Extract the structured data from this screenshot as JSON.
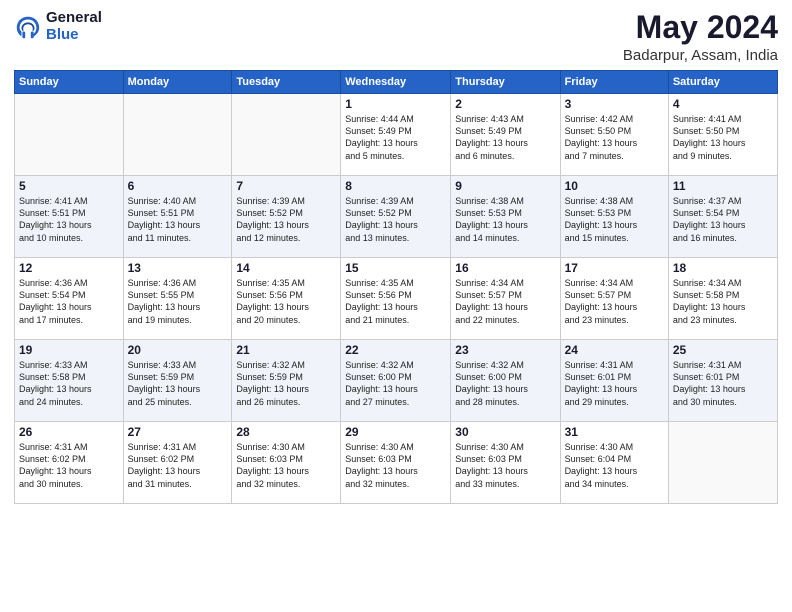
{
  "logo": {
    "general": "General",
    "blue": "Blue"
  },
  "title": "May 2024",
  "subtitle": "Badarpur, Assam, India",
  "headers": [
    "Sunday",
    "Monday",
    "Tuesday",
    "Wednesday",
    "Thursday",
    "Friday",
    "Saturday"
  ],
  "weeks": [
    [
      {
        "num": "",
        "info": ""
      },
      {
        "num": "",
        "info": ""
      },
      {
        "num": "",
        "info": ""
      },
      {
        "num": "1",
        "info": "Sunrise: 4:44 AM\nSunset: 5:49 PM\nDaylight: 13 hours\nand 5 minutes."
      },
      {
        "num": "2",
        "info": "Sunrise: 4:43 AM\nSunset: 5:49 PM\nDaylight: 13 hours\nand 6 minutes."
      },
      {
        "num": "3",
        "info": "Sunrise: 4:42 AM\nSunset: 5:50 PM\nDaylight: 13 hours\nand 7 minutes."
      },
      {
        "num": "4",
        "info": "Sunrise: 4:41 AM\nSunset: 5:50 PM\nDaylight: 13 hours\nand 9 minutes."
      }
    ],
    [
      {
        "num": "5",
        "info": "Sunrise: 4:41 AM\nSunset: 5:51 PM\nDaylight: 13 hours\nand 10 minutes."
      },
      {
        "num": "6",
        "info": "Sunrise: 4:40 AM\nSunset: 5:51 PM\nDaylight: 13 hours\nand 11 minutes."
      },
      {
        "num": "7",
        "info": "Sunrise: 4:39 AM\nSunset: 5:52 PM\nDaylight: 13 hours\nand 12 minutes."
      },
      {
        "num": "8",
        "info": "Sunrise: 4:39 AM\nSunset: 5:52 PM\nDaylight: 13 hours\nand 13 minutes."
      },
      {
        "num": "9",
        "info": "Sunrise: 4:38 AM\nSunset: 5:53 PM\nDaylight: 13 hours\nand 14 minutes."
      },
      {
        "num": "10",
        "info": "Sunrise: 4:38 AM\nSunset: 5:53 PM\nDaylight: 13 hours\nand 15 minutes."
      },
      {
        "num": "11",
        "info": "Sunrise: 4:37 AM\nSunset: 5:54 PM\nDaylight: 13 hours\nand 16 minutes."
      }
    ],
    [
      {
        "num": "12",
        "info": "Sunrise: 4:36 AM\nSunset: 5:54 PM\nDaylight: 13 hours\nand 17 minutes."
      },
      {
        "num": "13",
        "info": "Sunrise: 4:36 AM\nSunset: 5:55 PM\nDaylight: 13 hours\nand 19 minutes."
      },
      {
        "num": "14",
        "info": "Sunrise: 4:35 AM\nSunset: 5:56 PM\nDaylight: 13 hours\nand 20 minutes."
      },
      {
        "num": "15",
        "info": "Sunrise: 4:35 AM\nSunset: 5:56 PM\nDaylight: 13 hours\nand 21 minutes."
      },
      {
        "num": "16",
        "info": "Sunrise: 4:34 AM\nSunset: 5:57 PM\nDaylight: 13 hours\nand 22 minutes."
      },
      {
        "num": "17",
        "info": "Sunrise: 4:34 AM\nSunset: 5:57 PM\nDaylight: 13 hours\nand 23 minutes."
      },
      {
        "num": "18",
        "info": "Sunrise: 4:34 AM\nSunset: 5:58 PM\nDaylight: 13 hours\nand 23 minutes."
      }
    ],
    [
      {
        "num": "19",
        "info": "Sunrise: 4:33 AM\nSunset: 5:58 PM\nDaylight: 13 hours\nand 24 minutes."
      },
      {
        "num": "20",
        "info": "Sunrise: 4:33 AM\nSunset: 5:59 PM\nDaylight: 13 hours\nand 25 minutes."
      },
      {
        "num": "21",
        "info": "Sunrise: 4:32 AM\nSunset: 5:59 PM\nDaylight: 13 hours\nand 26 minutes."
      },
      {
        "num": "22",
        "info": "Sunrise: 4:32 AM\nSunset: 6:00 PM\nDaylight: 13 hours\nand 27 minutes."
      },
      {
        "num": "23",
        "info": "Sunrise: 4:32 AM\nSunset: 6:00 PM\nDaylight: 13 hours\nand 28 minutes."
      },
      {
        "num": "24",
        "info": "Sunrise: 4:31 AM\nSunset: 6:01 PM\nDaylight: 13 hours\nand 29 minutes."
      },
      {
        "num": "25",
        "info": "Sunrise: 4:31 AM\nSunset: 6:01 PM\nDaylight: 13 hours\nand 30 minutes."
      }
    ],
    [
      {
        "num": "26",
        "info": "Sunrise: 4:31 AM\nSunset: 6:02 PM\nDaylight: 13 hours\nand 30 minutes."
      },
      {
        "num": "27",
        "info": "Sunrise: 4:31 AM\nSunset: 6:02 PM\nDaylight: 13 hours\nand 31 minutes."
      },
      {
        "num": "28",
        "info": "Sunrise: 4:30 AM\nSunset: 6:03 PM\nDaylight: 13 hours\nand 32 minutes."
      },
      {
        "num": "29",
        "info": "Sunrise: 4:30 AM\nSunset: 6:03 PM\nDaylight: 13 hours\nand 32 minutes."
      },
      {
        "num": "30",
        "info": "Sunrise: 4:30 AM\nSunset: 6:03 PM\nDaylight: 13 hours\nand 33 minutes."
      },
      {
        "num": "31",
        "info": "Sunrise: 4:30 AM\nSunset: 6:04 PM\nDaylight: 13 hours\nand 34 minutes."
      },
      {
        "num": "",
        "info": ""
      }
    ]
  ]
}
